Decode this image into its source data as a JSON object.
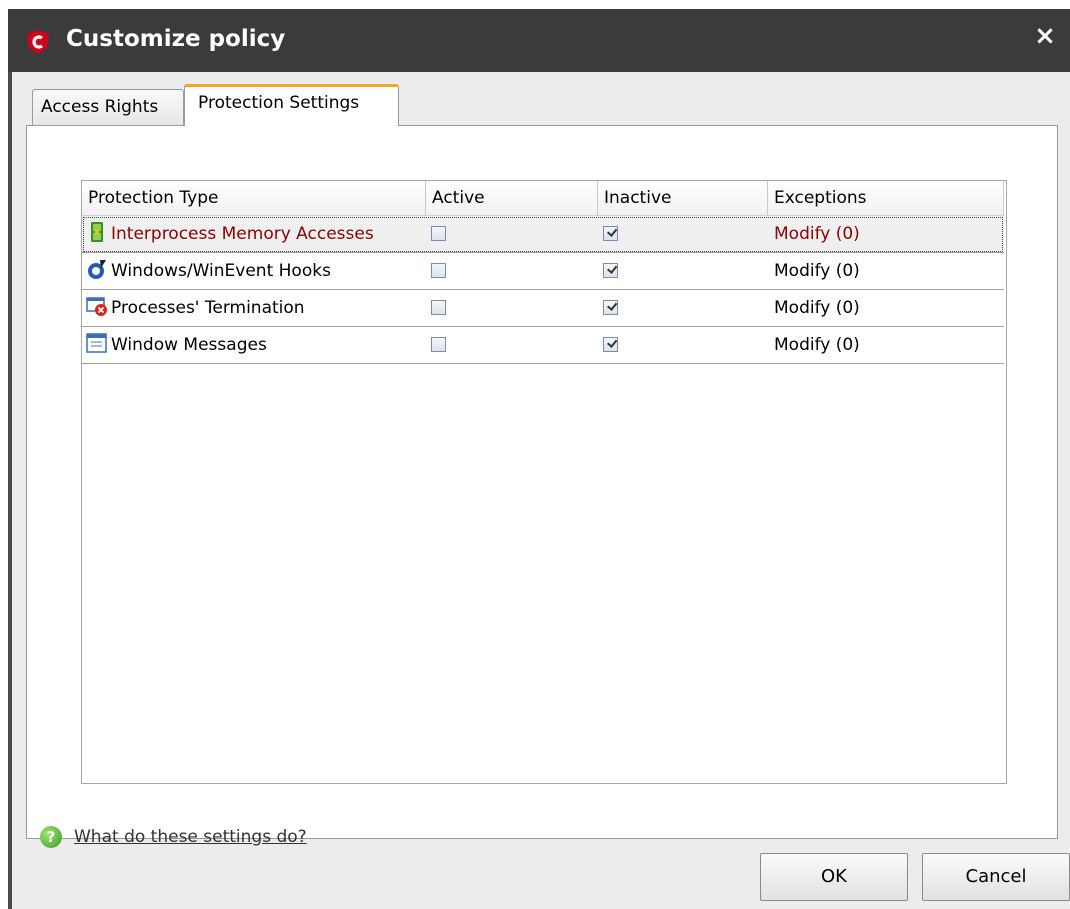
{
  "window": {
    "title": "Customize policy",
    "close_symbol": "×"
  },
  "tabs": [
    {
      "label": "Access Rights",
      "selected": false
    },
    {
      "label": "Protection Settings",
      "selected": true
    }
  ],
  "table": {
    "columns": [
      "Protection Type",
      "Active",
      "Inactive",
      "Exceptions"
    ],
    "rows": [
      {
        "icon": "memory-chip-icon",
        "type": "Interprocess Memory Accesses",
        "active": false,
        "inactive": true,
        "exceptions": "Modify (0)",
        "selected": true
      },
      {
        "icon": "hook-icon",
        "type": "Windows/WinEvent Hooks",
        "active": false,
        "inactive": true,
        "exceptions": "Modify (0)",
        "selected": false
      },
      {
        "icon": "process-terminate-icon",
        "type": "Processes' Termination",
        "active": false,
        "inactive": true,
        "exceptions": "Modify (0)",
        "selected": false
      },
      {
        "icon": "window-messages-icon",
        "type": "Window Messages",
        "active": false,
        "inactive": true,
        "exceptions": "Modify (0)",
        "selected": false
      }
    ]
  },
  "help": {
    "icon": "help-icon",
    "link_text": "What do these settings do?"
  },
  "buttons": {
    "ok": "OK",
    "cancel": "Cancel"
  },
  "colors": {
    "titlebar": "#3b3b3b",
    "tab_accent": "#f5a623",
    "selected_text": "#8b0000",
    "logo_red": "#d0021b"
  }
}
